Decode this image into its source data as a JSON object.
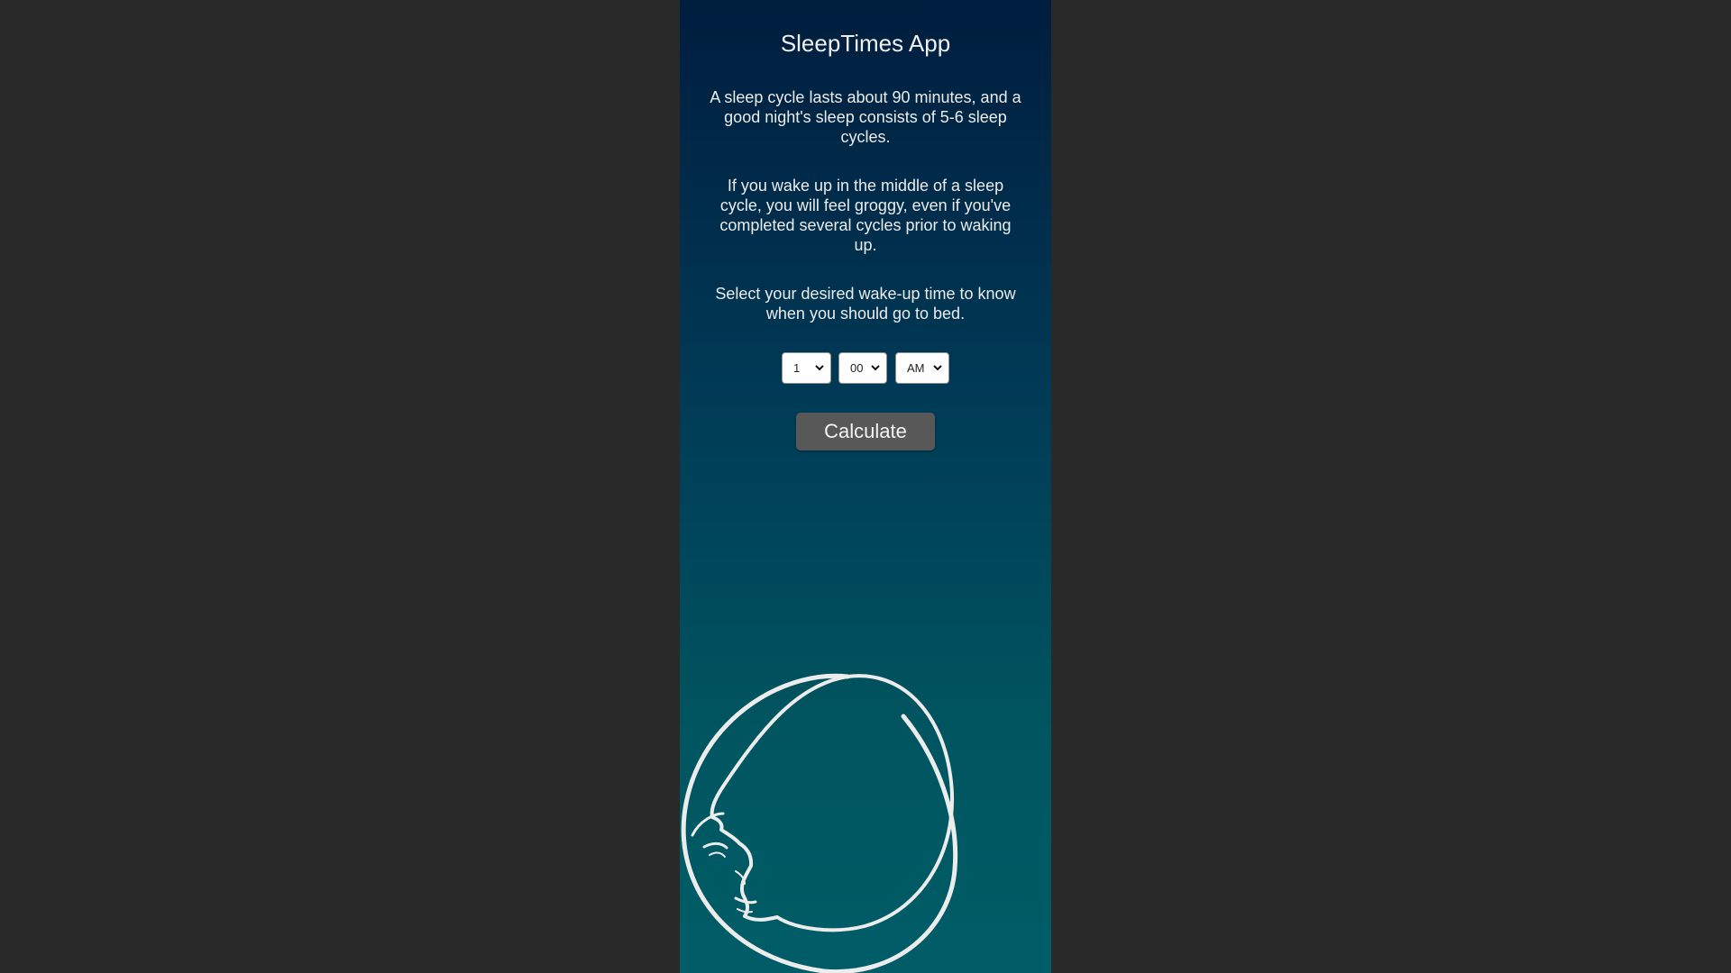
{
  "app": {
    "title": "SleepTimes App",
    "paragraphs": [
      "A sleep cycle lasts about 90 minutes, and a good night's sleep consists of 5-6 sleep cycles.",
      "If you wake up in the middle of a sleep cycle, you will feel groggy, even if you've completed several cycles prior to waking up.",
      "Select your desired wake-up time to know when you should go to bed."
    ],
    "time": {
      "hour": "1",
      "minute": "00",
      "period": "AM"
    },
    "calculate_label": "Calculate",
    "illustration_icon": "crescent-moon-face-icon"
  },
  "colors": {
    "page_background": "#292929",
    "panel_top": "#001d3e",
    "panel_bottom": "#005d67",
    "button": "#585858",
    "text": "#ececec"
  }
}
